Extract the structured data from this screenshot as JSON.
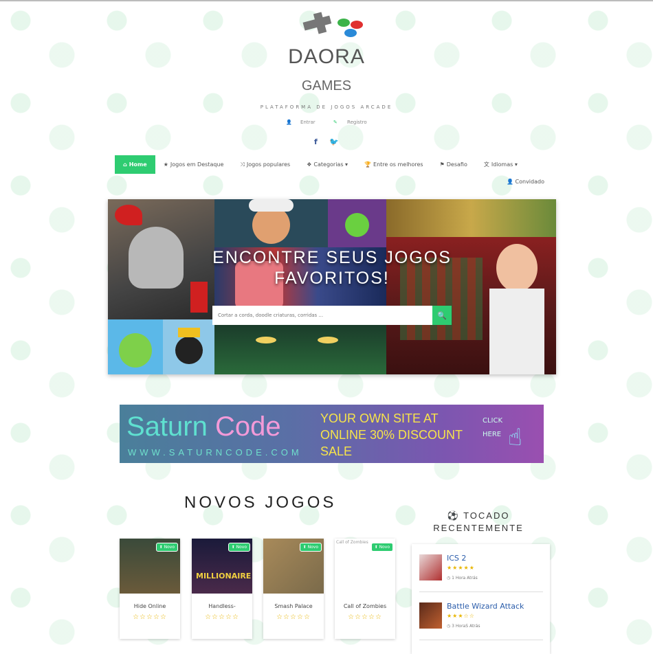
{
  "site": {
    "title_line1": "DAORA",
    "title_line2": "GAMES",
    "tagline": "PLATAFORMA DE JOGOS ARCADE",
    "login": "Entrar",
    "register": "Registro",
    "accent_color": "#2ecc71"
  },
  "social": {
    "facebook": "f",
    "twitter": "🐦"
  },
  "nav": {
    "home": "Home",
    "featured": "Jogos em Destaque",
    "popular": "Jogos populares",
    "categories": "Categorias ▾",
    "best": "Entre os melhores",
    "challenge": "Desafio",
    "languages": "Idiomas ▾",
    "guest": "Convidado"
  },
  "hero": {
    "title_line1": "ENCONTRE SEUS JOGOS",
    "title_line2": "FAVORITOS!",
    "search_placeholder": "Cortar a corda, doodle criaturas, corridas ..."
  },
  "banner": {
    "brand_part1": "Saturn ",
    "brand_part2": "Code",
    "url": "WWW.SATURNCODE.COM",
    "offer": "YOUR OWN SITE AT ONLINE 30% DISCOUNT SALE",
    "click_line1": "CLICK",
    "click_line2": "HERE"
  },
  "new_games": {
    "title": "NOVOS JOGOS",
    "badge": "Novo",
    "items": [
      {
        "name": "Hide Online",
        "rating": 0
      },
      {
        "name": "Handless-",
        "rating": 0
      },
      {
        "name": "Smash Palace",
        "rating": 0
      },
      {
        "name": "Call of Zombies",
        "rating": 0,
        "alt_text": "Call of Zombies"
      }
    ]
  },
  "recent": {
    "icon": "soccer-ball-icon",
    "title_line1": "⚽ TOCADO",
    "title_line2": "RECENTEMENTE",
    "items": [
      {
        "name": "ICS 2",
        "stars": "★★★★★",
        "time": "1 Hora Atrás"
      },
      {
        "name": "Battle Wizard Attack",
        "stars": "★★★☆☆",
        "time": "3 HoraS Atrás"
      }
    ]
  }
}
